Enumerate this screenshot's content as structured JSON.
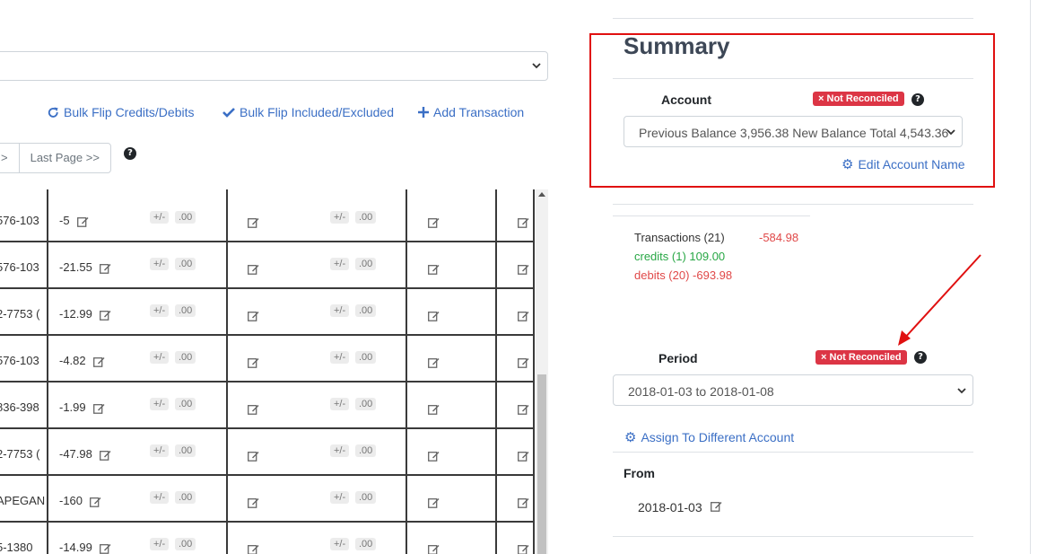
{
  "toolbar": {
    "bulk_flip_credits": "Bulk Flip Credits/Debits",
    "bulk_flip_included": "Bulk Flip Included/Excluded",
    "add_transaction": "Add Transaction"
  },
  "pager": {
    "prev_fragment": ">",
    "last_page": "Last Page >>"
  },
  "table": {
    "plus_minus": "+/-",
    "cents": ".00",
    "rows": [
      {
        "desc": "576-103",
        "amount": "-5"
      },
      {
        "desc": "576-103",
        "amount": "-21.55"
      },
      {
        "desc": "2-7753 (",
        "amount": "-12.99"
      },
      {
        "desc": "576-103",
        "amount": "-4.82"
      },
      {
        "desc": "836-398",
        "amount": "-1.99"
      },
      {
        "desc": "2-7753 (",
        "amount": "-47.98"
      },
      {
        "desc": "APEGAN",
        "amount": "-160"
      },
      {
        "desc": "5-1380",
        "amount": "-14.99"
      }
    ]
  },
  "summary": {
    "title": "Summary",
    "account_label": "Account",
    "account_status": "Not Reconciled",
    "account_select_value": "Previous Balance 3,956.38 New Balance Total 4,543.36",
    "edit_account_name": "Edit Account Name",
    "transactions_label": "Transactions (21)",
    "transactions_total": "-584.98",
    "credits": "credits (1) 109.00",
    "debits": "debits (20) -693.98",
    "period_label": "Period",
    "period_status": "Not Reconciled",
    "period_select_value": "2018-01-03 to 2018-01-08",
    "assign_account": "Assign To Different Account",
    "from_label": "From",
    "from_date": "2018-01-03"
  },
  "colors": {
    "link": "#3b6fc5",
    "danger": "#dc3545",
    "credit": "#28a745",
    "debit": "#e04848",
    "annotation": "#e01010"
  }
}
